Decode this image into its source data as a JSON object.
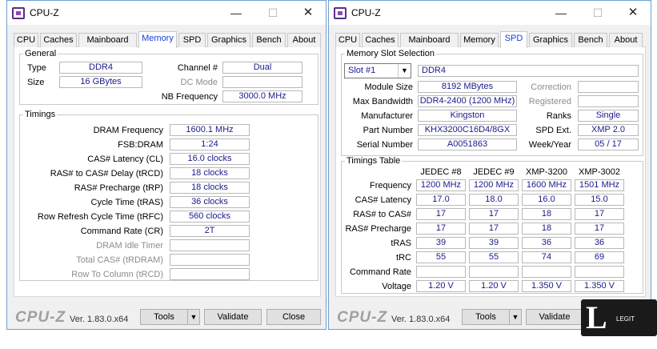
{
  "left": {
    "title": "CPU-Z",
    "tabs": [
      "CPU",
      "Caches",
      "Mainboard",
      "Memory",
      "SPD",
      "Graphics",
      "Bench",
      "About"
    ],
    "active_tab": "Memory",
    "general": {
      "title": "General",
      "type_label": "Type",
      "type_value": "DDR4",
      "size_label": "Size",
      "size_value": "16 GBytes",
      "channel_label": "Channel #",
      "channel_value": "Dual",
      "dc_mode_label": "DC Mode",
      "dc_mode_value": "",
      "nb_freq_label": "NB Frequency",
      "nb_freq_value": "3000.0 MHz"
    },
    "timings": {
      "title": "Timings",
      "rows": [
        {
          "label": "DRAM Frequency",
          "value": "1600.1 MHz"
        },
        {
          "label": "FSB:DRAM",
          "value": "1:24"
        },
        {
          "label": "CAS# Latency (CL)",
          "value": "16.0 clocks"
        },
        {
          "label": "RAS# to CAS# Delay (tRCD)",
          "value": "18 clocks"
        },
        {
          "label": "RAS# Precharge (tRP)",
          "value": "18 clocks"
        },
        {
          "label": "Cycle Time (tRAS)",
          "value": "36 clocks"
        },
        {
          "label": "Row Refresh Cycle Time (tRFC)",
          "value": "560 clocks"
        },
        {
          "label": "Command Rate (CR)",
          "value": "2T"
        },
        {
          "label": "DRAM Idle Timer",
          "value": ""
        },
        {
          "label": "Total CAS# (tRDRAM)",
          "value": ""
        },
        {
          "label": "Row To Column (tRCD)",
          "value": ""
        }
      ]
    },
    "bottom": {
      "brand": "CPU-Z",
      "version": "Ver. 1.83.0.x64",
      "tools": "Tools",
      "validate": "Validate",
      "close": "Close"
    }
  },
  "right": {
    "title": "CPU-Z",
    "tabs": [
      "CPU",
      "Caches",
      "Mainboard",
      "Memory",
      "SPD",
      "Graphics",
      "Bench",
      "About"
    ],
    "active_tab": "SPD",
    "slot": {
      "title": "Memory Slot Selection",
      "selected": "Slot #1",
      "type_value": "DDR4",
      "module_size_label": "Module Size",
      "module_size_value": "8192 MBytes",
      "max_bw_label": "Max Bandwidth",
      "max_bw_value": "DDR4-2400 (1200 MHz)",
      "manufacturer_label": "Manufacturer",
      "manufacturer_value": "Kingston",
      "part_label": "Part Number",
      "part_value": "KHX3200C16D4/8GX",
      "serial_label": "Serial Number",
      "serial_value": "A0051863",
      "correction_label": "Correction",
      "correction_value": "",
      "registered_label": "Registered",
      "registered_value": "",
      "ranks_label": "Ranks",
      "ranks_value": "Single",
      "spd_ext_label": "SPD Ext.",
      "spd_ext_value": "XMP 2.0",
      "week_year_label": "Week/Year",
      "week_year_value": "05 / 17"
    },
    "timings_table": {
      "title": "Timings Table",
      "columns": [
        "JEDEC #8",
        "JEDEC #9",
        "XMP-3200",
        "XMP-3002"
      ],
      "rows": [
        {
          "label": "Frequency",
          "values": [
            "1200 MHz",
            "1200 MHz",
            "1600 MHz",
            "1501 MHz"
          ]
        },
        {
          "label": "CAS# Latency",
          "values": [
            "17.0",
            "18.0",
            "16.0",
            "15.0"
          ]
        },
        {
          "label": "RAS# to CAS#",
          "values": [
            "17",
            "17",
            "18",
            "17"
          ]
        },
        {
          "label": "RAS# Precharge",
          "values": [
            "17",
            "17",
            "18",
            "17"
          ]
        },
        {
          "label": "tRAS",
          "values": [
            "39",
            "39",
            "36",
            "36"
          ]
        },
        {
          "label": "tRC",
          "values": [
            "55",
            "55",
            "74",
            "69"
          ]
        },
        {
          "label": "Command Rate",
          "values": [
            "",
            "",
            "",
            ""
          ]
        },
        {
          "label": "Voltage",
          "values": [
            "1.20 V",
            "1.20 V",
            "1.350 V",
            "1.350 V"
          ]
        }
      ]
    },
    "bottom": {
      "brand": "CPU-Z",
      "version": "Ver. 1.83.0.x64",
      "tools": "Tools",
      "validate": "Validate"
    }
  },
  "watermark": {
    "logo": "L",
    "sub": "LEGIT"
  },
  "colors": {
    "value_text": "#1a1a8c",
    "active_tab": "#1a3ed6",
    "window_border": "#6f9fce"
  }
}
